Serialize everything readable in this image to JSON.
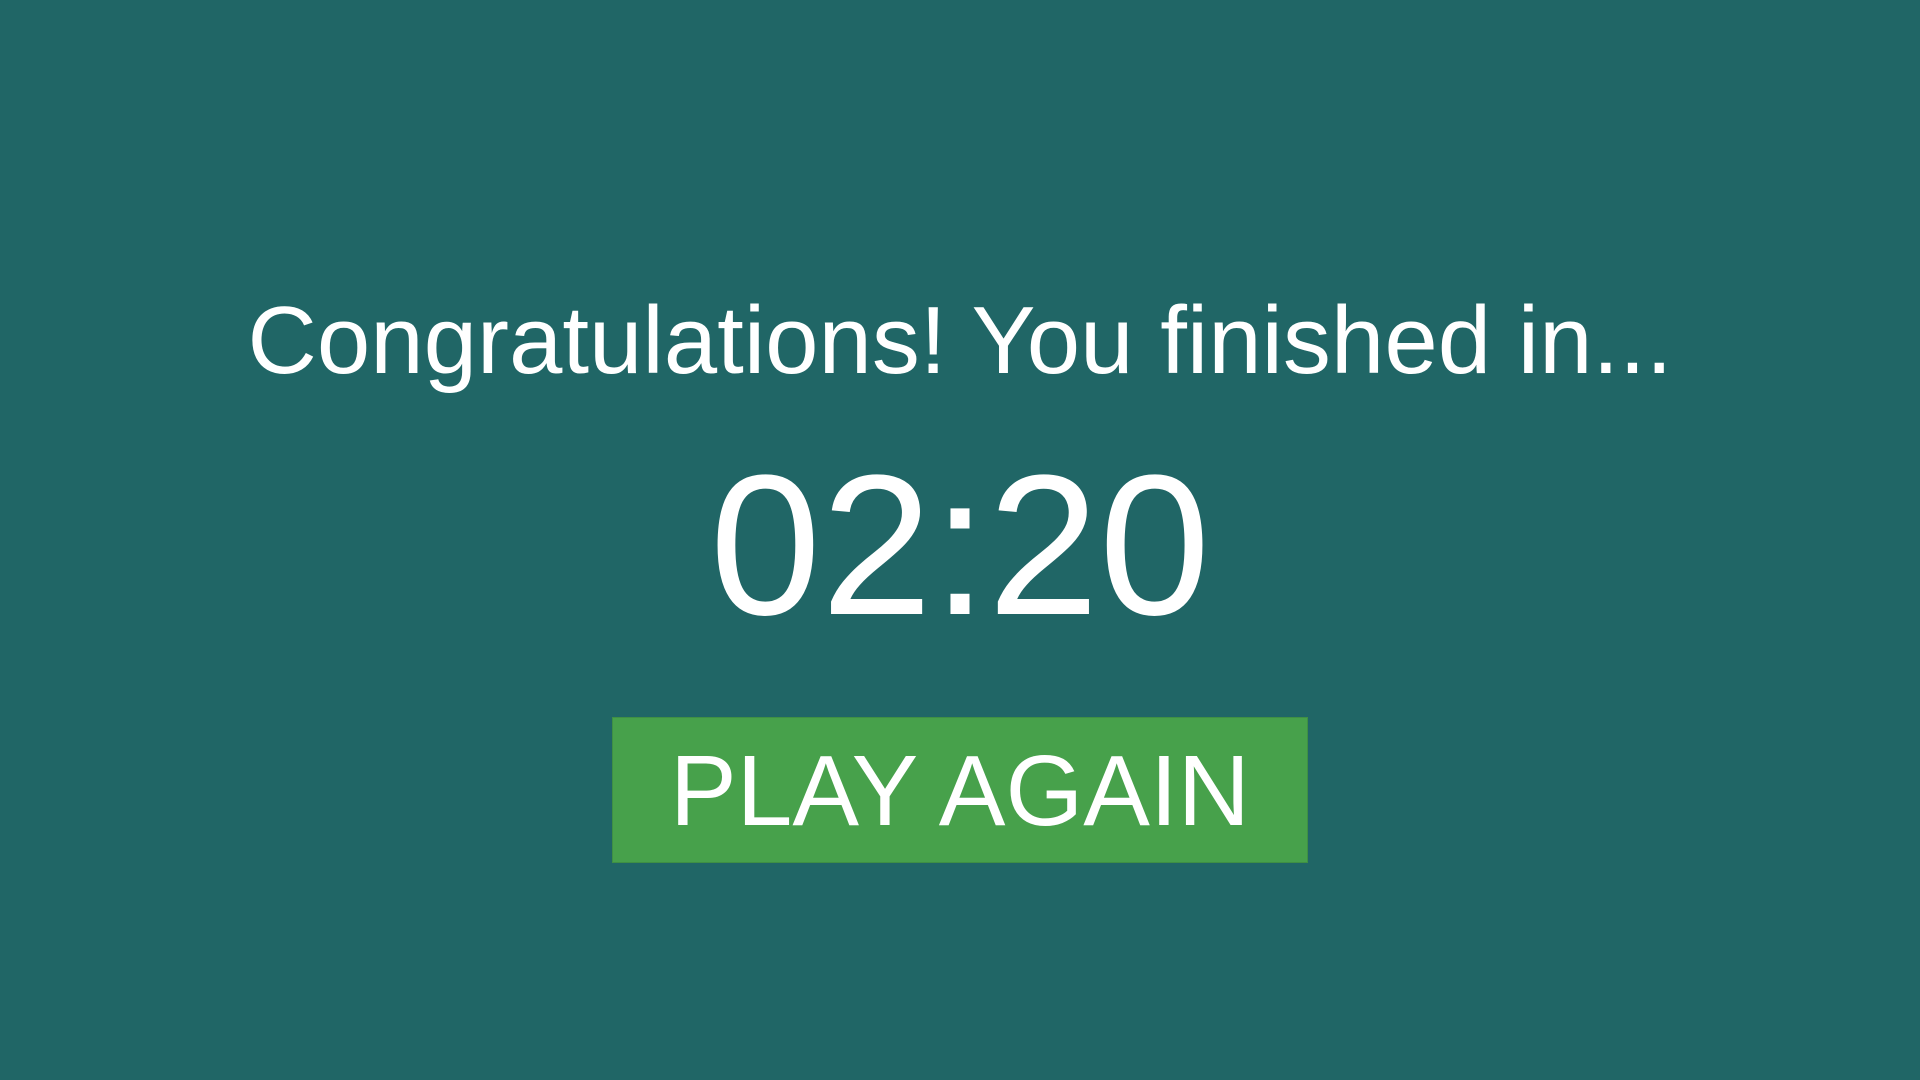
{
  "game_over": {
    "message": "Congratulations! You finished in...",
    "time": "02:20",
    "play_again_label": "PLAY AGAIN"
  },
  "colors": {
    "background": "#206666",
    "button": "#47a14b",
    "text": "#ffffff"
  }
}
